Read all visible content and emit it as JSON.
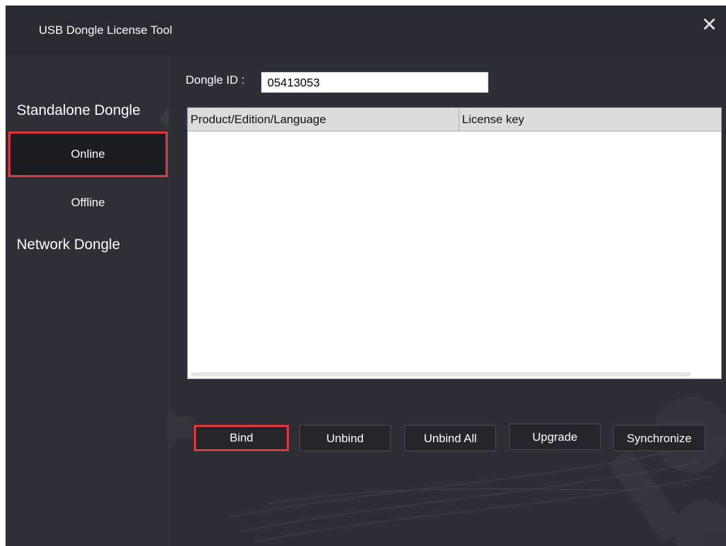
{
  "window": {
    "title": "USB Dongle License Tool",
    "close_symbol": "✕"
  },
  "sidebar": {
    "groups": [
      {
        "title": "Standalone Dongle",
        "items": [
          {
            "label": "Online",
            "selected": true
          },
          {
            "label": "Offline",
            "selected": false
          }
        ]
      },
      {
        "title": "Network Dongle",
        "items": []
      }
    ]
  },
  "main": {
    "dongle_id_label": "Dongle ID :",
    "dongle_id_value": "05413053",
    "table": {
      "columns": [
        "Product/Edition/Language",
        "License key"
      ],
      "rows": []
    },
    "buttons": [
      {
        "label": "Bind",
        "highlighted": true
      },
      {
        "label": "Unbind",
        "highlighted": false
      },
      {
        "label": "Unbind All",
        "highlighted": false
      },
      {
        "label": "Upgrade",
        "highlighted": false
      },
      {
        "label": "Synchronize",
        "highlighted": false
      }
    ]
  },
  "colors": {
    "background": "#2e2e36",
    "selected_item": "#1c1d23",
    "highlight_border": "#e0393b",
    "button": "#25262c"
  },
  "icons": [
    "close-icon"
  ]
}
